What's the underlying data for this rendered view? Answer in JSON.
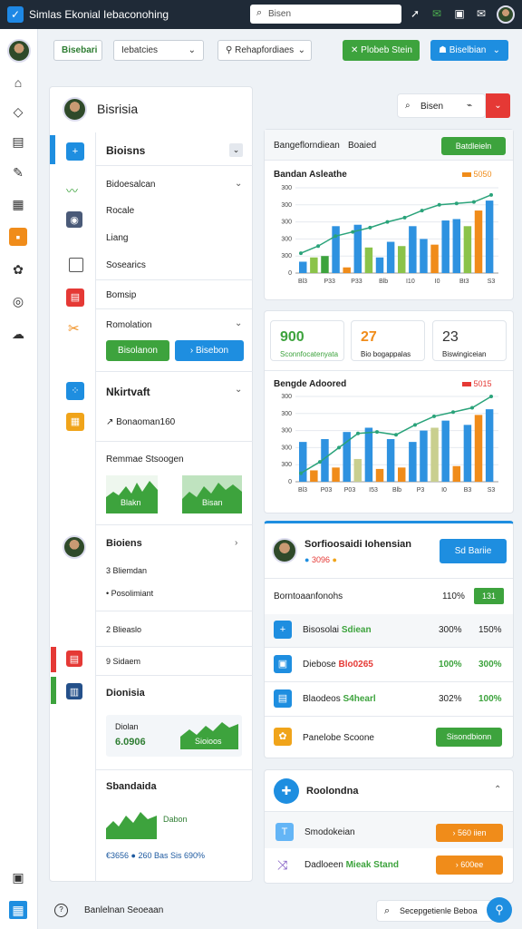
{
  "app": {
    "title": "Simlas Ekonial Iebaconohing",
    "search_placeholder": "Bisen"
  },
  "toolbar": {
    "left_btn": "Bisebari",
    "dropdown1": "Iebatcies",
    "dropdown2": "Rehapfordiaes",
    "green_btn": "Plobeb Stein",
    "blue_btn": "Biselbian"
  },
  "left_panel": {
    "title": "Bisrisia",
    "s1_title": "Bioisns",
    "s1_items": [
      "Bidoesalcan",
      "Rocale",
      "Liang",
      "Sosearics",
      "Bomsip"
    ],
    "s2_title": "Romolation",
    "s2_btn_green": "Bisolanon",
    "s2_btn_blue": "Bisebon",
    "s3_title": "Nkirtvaft",
    "s3_item": "Bonaoman160",
    "s3_sub": "Remmae Stsoogen",
    "s3_spark1": "Blakn",
    "s3_spark2": "Bisan",
    "s4_title": "Bioiens",
    "s4_items": [
      "Bliemdan",
      "Posolimiant",
      "Blieaslo",
      "Sidaem"
    ],
    "s5_title": "Dionisia",
    "s5_card_label": "Diolan",
    "s5_card_value": "6.0906",
    "s5_card_badge": "Sioioos",
    "s6_title": "Sbandaida",
    "s6_spark_label": "Dabon",
    "s6_stats": "€3656 ● 260 Bas Sis 690%"
  },
  "chart1": {
    "header_left": "Bangeflorndiean",
    "header_mid": "Boaied",
    "header_btn": "Batdleieln",
    "title": "Bandan Asleathe",
    "legend": "5050"
  },
  "chart2": {
    "title": "Bengde Adoored",
    "legend": "5015"
  },
  "stats": [
    {
      "value": "900",
      "label": "Sconnfocatenyata"
    },
    {
      "value": "27",
      "label": "Bio bogappalas"
    },
    {
      "value": "23",
      "label": "Biswingiceian"
    }
  ],
  "profile": {
    "name": "Sorfioosaidi Iohensian",
    "rating": "3096",
    "btn": "Sd Bariie",
    "row0_label": "Borntoaanfonohs",
    "row0_pct": "110%",
    "row0_badge": "131",
    "rows": [
      {
        "label": "Bisosolai",
        "val": "Sdiean",
        "a": "300%",
        "b": "150%"
      },
      {
        "label": "Diebose",
        "val": "Blo0265",
        "a": "100%",
        "b": "300%"
      },
      {
        "label": "Blaodeos",
        "val": "S4hearl",
        "a": "302%",
        "b": "100%"
      }
    ],
    "row4_label": "Panelobe Scoone",
    "row4_btn": "Sisondbionn"
  },
  "bottom_card": {
    "title": "Roolondna",
    "r1_label": "Smodokeian",
    "r1_btn": "› 560 iien",
    "r2_label": "Dadloeen",
    "r2_label2": "Mieak Stand",
    "r2_btn": "› 600ee"
  },
  "footer": {
    "text": "Banlelnan Seoeaan",
    "search": "Secepgetienle Beboa"
  },
  "colors": {
    "green": "#3da33d",
    "blue": "#1e8ee0",
    "orange": "#f08c1a",
    "red": "#e53935",
    "lightgreen": "#8bc34a",
    "tealline": "#2aa37a"
  },
  "chart_data": [
    {
      "type": "bar",
      "title": "Bandan Asleathe",
      "y_ticks": [
        "300",
        "300",
        "300",
        "300",
        "300",
        "0"
      ],
      "x_ticks": [
        "Bl3",
        "P33",
        "P33",
        "Blb",
        "I10",
        "I0",
        "Bt3",
        "S3"
      ],
      "bars": [
        {
          "value": 40,
          "color": "#2e92e0"
        },
        {
          "value": 55,
          "color": "#8bc34a"
        },
        {
          "value": 60,
          "color": "#3da33d"
        },
        {
          "value": 165,
          "color": "#2e92e0"
        },
        {
          "value": 20,
          "color": "#f08c1a"
        },
        {
          "value": 170,
          "color": "#2e92e0"
        },
        {
          "value": 90,
          "color": "#8bc34a"
        },
        {
          "value": 55,
          "color": "#2e92e0"
        },
        {
          "value": 110,
          "color": "#2e92e0"
        },
        {
          "value": 95,
          "color": "#8bc34a"
        },
        {
          "value": 165,
          "color": "#2e92e0"
        },
        {
          "value": 120,
          "color": "#2e92e0"
        },
        {
          "value": 100,
          "color": "#f08c1a"
        },
        {
          "value": 185,
          "color": "#2e92e0"
        },
        {
          "value": 190,
          "color": "#2e92e0"
        },
        {
          "value": 165,
          "color": "#8bc34a"
        },
        {
          "value": 220,
          "color": "#f08c1a"
        },
        {
          "value": 255,
          "color": "#2e92e0"
        }
      ],
      "line": [
        70,
        95,
        130,
        145,
        160,
        180,
        195,
        220,
        240,
        245,
        250,
        275
      ],
      "ylim": [
        0,
        300
      ]
    },
    {
      "type": "bar",
      "title": "Bengde Adoored",
      "y_ticks": [
        "300",
        "300",
        "300",
        "300",
        "300",
        "0"
      ],
      "x_ticks": [
        "Bl3",
        "P03",
        "P03",
        "I53",
        "Blb",
        "P3",
        "I0",
        "B3",
        "S3"
      ],
      "bars": [
        {
          "value": 140,
          "color": "#2e92e0"
        },
        {
          "value": 40,
          "color": "#f08c1a"
        },
        {
          "value": 150,
          "color": "#2e92e0"
        },
        {
          "value": 50,
          "color": "#f08c1a"
        },
        {
          "value": 175,
          "color": "#2e92e0"
        },
        {
          "value": 80,
          "color": "#c9cf8f"
        },
        {
          "value": 190,
          "color": "#2e92e0"
        },
        {
          "value": 45,
          "color": "#f08c1a"
        },
        {
          "value": 150,
          "color": "#2e92e0"
        },
        {
          "value": 50,
          "color": "#f08c1a"
        },
        {
          "value": 140,
          "color": "#2e92e0"
        },
        {
          "value": 180,
          "color": "#2e92e0"
        },
        {
          "value": 190,
          "color": "#c9cf8f"
        },
        {
          "value": 215,
          "color": "#2e92e0"
        },
        {
          "value": 55,
          "color": "#f08c1a"
        },
        {
          "value": 200,
          "color": "#2e92e0"
        },
        {
          "value": 235,
          "color": "#f08c1a"
        },
        {
          "value": 255,
          "color": "#2e92e0"
        }
      ],
      "line": [
        30,
        70,
        120,
        170,
        175,
        165,
        200,
        230,
        245,
        260,
        300
      ],
      "ylim": [
        0,
        300
      ]
    }
  ]
}
